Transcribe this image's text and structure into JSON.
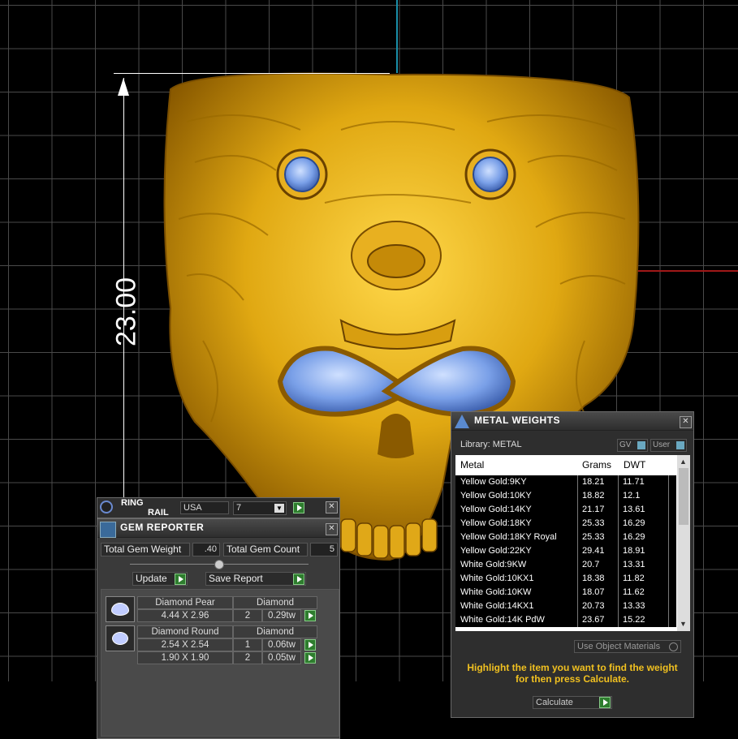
{
  "viewport": {
    "dimension_label": "23.00"
  },
  "ring_rail": {
    "title_line1": "RING",
    "title_line2": "RAIL",
    "country": "USA",
    "size": "7"
  },
  "gem_reporter": {
    "title": "GEM REPORTER",
    "total_weight_label": "Total Gem Weight",
    "total_weight_value": ".40",
    "total_count_label": "Total Gem Count",
    "total_count_value": "5",
    "update_label": "Update",
    "save_label": "Save Report",
    "gems": [
      {
        "name": "Diamond Pear",
        "material": "Diamond",
        "rows": [
          {
            "dims": "4.44 X 2.96",
            "count": "2",
            "weight": "0.29tw"
          }
        ]
      },
      {
        "name": "Diamond Round",
        "material": "Diamond",
        "rows": [
          {
            "dims": "2.54 X 2.54",
            "count": "1",
            "weight": "0.06tw"
          },
          {
            "dims": "1.90 X 1.90",
            "count": "2",
            "weight": "0.05tw"
          }
        ]
      }
    ]
  },
  "metal_weights": {
    "title": "METAL WEIGHTS",
    "library_label": "Library: METAL",
    "gv_label": "GV",
    "user_label": "User",
    "columns": [
      "Metal",
      "Grams",
      "DWT"
    ],
    "rows": [
      [
        "Yellow Gold:9KY",
        "18.21",
        "11.71"
      ],
      [
        "Yellow Gold:10KY",
        "18.82",
        "12.1"
      ],
      [
        "Yellow Gold:14KY",
        "21.17",
        "13.61"
      ],
      [
        "Yellow Gold:18KY",
        "25.33",
        "16.29"
      ],
      [
        "Yellow Gold:18KY Royal",
        "25.33",
        "16.29"
      ],
      [
        "Yellow Gold:22KY",
        "29.41",
        "18.91"
      ],
      [
        "White Gold:9KW",
        "20.7",
        "13.31"
      ],
      [
        "White Gold:10KX1",
        "18.38",
        "11.82"
      ],
      [
        "White Gold:10KW",
        "18.07",
        "11.62"
      ],
      [
        "White Gold:14KX1",
        "20.73",
        "13.33"
      ],
      [
        "White Gold:14K PdW",
        "23.67",
        "15.22"
      ]
    ],
    "use_object_materials_label": "Use Object Materials",
    "instruction": "Highlight the item you want to find the weight for then press Calculate.",
    "calculate_label": "Calculate",
    "instruction_color": "#f0c020"
  }
}
